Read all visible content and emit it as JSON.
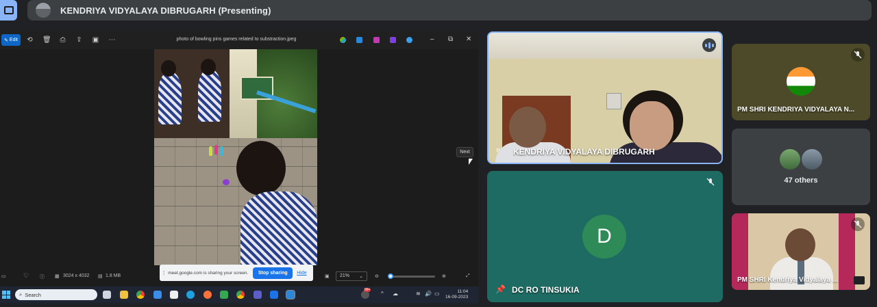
{
  "meeting": {
    "presenting_label": "KENDRIYA VIDYALAYA DIBRUGARH (Presenting)"
  },
  "photos_app": {
    "edit_label": "Edit",
    "file_title": "photo of bowling pins games related to substraction.jpeg",
    "next_tooltip": "Next",
    "dimensions": "3024 x 4032",
    "file_size": "1.8 MB",
    "zoom_level": "21%",
    "zoom_fraction": 0.05
  },
  "share_banner": {
    "message": "meet.google.com is sharing your screen.",
    "stop_label": "Stop sharing",
    "hide_label": "Hide"
  },
  "taskbar": {
    "search_placeholder": "Search",
    "time": "11:04",
    "date": "16-09-2023",
    "notification_count": "99+"
  },
  "participants": [
    {
      "name": "KENDRIYA VIDYALAYA DIBRUGARH",
      "speaking": true
    },
    {
      "name": "DC RO TINSUKIA",
      "initial": "D",
      "muted": true
    },
    {
      "name": "PM SHRI KENDRIYA VIDYALAYA N...",
      "muted": true
    },
    {
      "name": "47 others"
    },
    {
      "name": "PM SHRI Kendriya Vidyalaya ...",
      "muted": true
    }
  ],
  "colors": {
    "accent": "#8ab4f8",
    "dc_tile": "#1e6b63",
    "stop_button": "#1a73e8"
  }
}
